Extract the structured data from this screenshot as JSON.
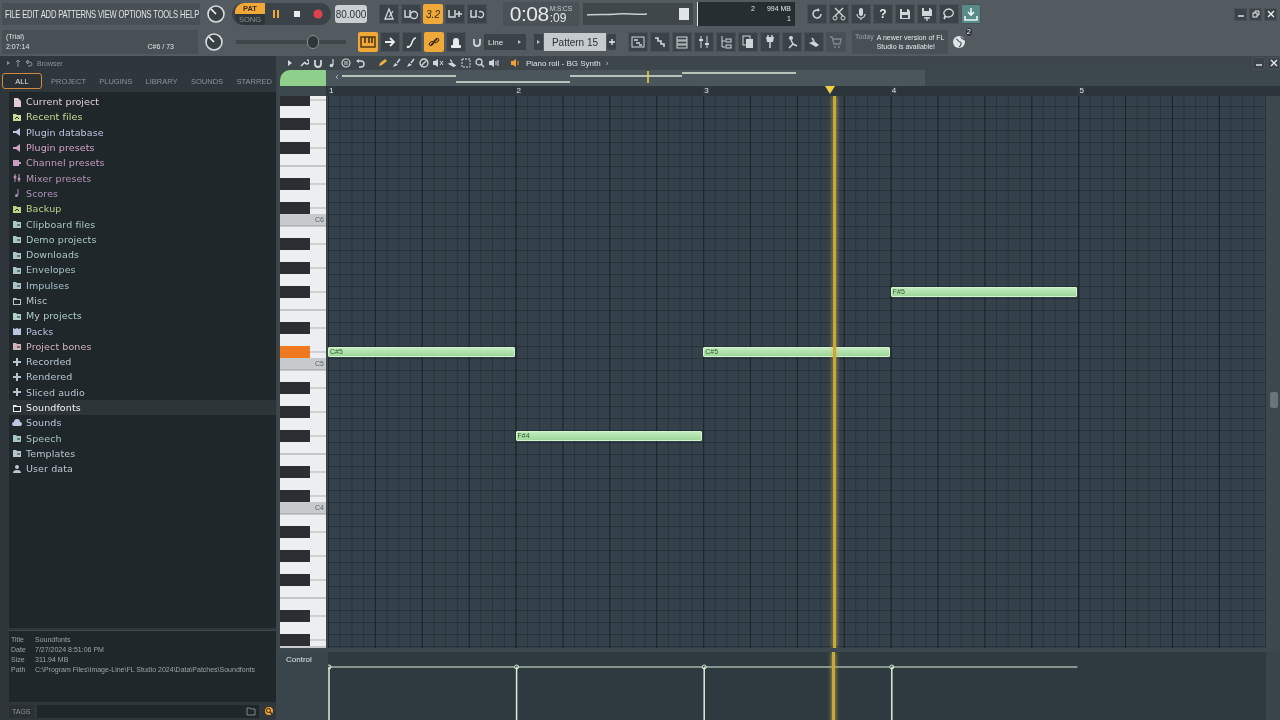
{
  "menu": [
    "FILE",
    "EDIT",
    "ADD",
    "PATTERNS",
    "VIEW",
    "OPTIONS",
    "TOOLS",
    "HELP"
  ],
  "hint_bar": {
    "status": "(Trial)",
    "time": "2:07:14",
    "note": "C#6 / 73"
  },
  "transport": {
    "pat_label": "PAT",
    "song_label": "SONG",
    "pat_selected": true,
    "tempo": "80.000"
  },
  "master_volume": {
    "level": 0.7
  },
  "toolbar_1": [
    {
      "on": false
    },
    {
      "on": false
    },
    {
      "label": "3.2",
      "on": true
    },
    {
      "on": false
    },
    {
      "on": false
    }
  ],
  "time_display": {
    "time": "0:08",
    "centiseconds": ":09",
    "unit": "M:S:CS"
  },
  "monitor": {
    "cpu": "2",
    "memory": "994 MB",
    "polyphony": "1"
  },
  "help_label": "?",
  "toolbar_2": [
    {
      "on": true
    },
    {
      "on": false
    },
    {
      "on": false
    },
    {
      "on": true
    },
    {
      "on": false
    }
  ],
  "snap": {
    "value": "Line"
  },
  "pattern": {
    "name": "Pattern 15"
  },
  "news": {
    "date": "Today",
    "message": "A newer version of FL Studio is available!",
    "count": "2"
  },
  "browser": {
    "title": "Browser",
    "tabs": [
      {
        "label": "ALL",
        "selected": true
      },
      {
        "label": "PROJECT",
        "selected": false
      },
      {
        "label": "PLUGINS",
        "selected": false
      },
      {
        "label": "LIBRARY",
        "selected": false
      },
      {
        "label": "SOUNDS",
        "selected": false
      },
      {
        "label": "STARRED",
        "selected": false
      }
    ],
    "items": [
      {
        "label": "Current project",
        "kind": "file",
        "color": "#e2ccd4",
        "selected": false
      },
      {
        "label": "Recent files",
        "kind": "recent",
        "color": "#cadc94",
        "selected": false
      },
      {
        "label": "Plugin database",
        "kind": "plugin",
        "color": "#bcc8e2",
        "selected": false
      },
      {
        "label": "Plugin presets",
        "kind": "plugin",
        "color": "#d8a2c8",
        "selected": false
      },
      {
        "label": "Channel presets",
        "kind": "channel",
        "color": "#c89cc0",
        "selected": false
      },
      {
        "label": "Mixer presets",
        "kind": "mixer",
        "color": "#b894b8",
        "selected": false
      },
      {
        "label": "Scores",
        "kind": "note",
        "color": "#aa94ba",
        "selected": false
      },
      {
        "label": "Backup",
        "kind": "recent",
        "color": "#bcd484",
        "selected": false
      },
      {
        "label": "Clipboard files",
        "kind": "folder",
        "color": "#aac8c2",
        "selected": false
      },
      {
        "label": "Demo projects",
        "kind": "folder",
        "color": "#aac8c8",
        "selected": false
      },
      {
        "label": "Downloads",
        "kind": "folder",
        "color": "#aac6ca",
        "selected": false
      },
      {
        "label": "Envelopes",
        "kind": "folder",
        "color": "#a8c4c8",
        "selected": false
      },
      {
        "label": "Impulses",
        "kind": "folder",
        "color": "#a8c2ca",
        "selected": false
      },
      {
        "label": "Misc",
        "kind": "plainfolder",
        "color": "#b8c4c8",
        "selected": false
      },
      {
        "label": "My projects",
        "kind": "folder",
        "color": "#b0d0c8",
        "selected": false
      },
      {
        "label": "Packs",
        "kind": "packs",
        "color": "#bac6e0",
        "selected": false
      },
      {
        "label": "Project bones",
        "kind": "folder",
        "color": "#d2b2b8",
        "selected": false
      },
      {
        "label": "Recorded",
        "kind": "audio",
        "color": "#b8c8d2",
        "selected": false
      },
      {
        "label": "Rendered",
        "kind": "audio",
        "color": "#b6c6d0",
        "selected": false
      },
      {
        "label": "Sliced audio",
        "kind": "audio",
        "color": "#b4c4ce",
        "selected": false
      },
      {
        "label": "Soundfonts",
        "kind": "plainfolder",
        "color": "#f2f4f4",
        "selected": true
      },
      {
        "label": "Sounds",
        "kind": "cloud",
        "color": "#bcc8e2",
        "selected": false
      },
      {
        "label": "Speech",
        "kind": "folder",
        "color": "#a8c6c8",
        "selected": false
      },
      {
        "label": "Templates",
        "kind": "folder",
        "color": "#b6c6ce",
        "selected": false
      },
      {
        "label": "User data",
        "kind": "user",
        "color": "#b8c8d0",
        "selected": false
      }
    ],
    "info": [
      {
        "label": "Title",
        "value": "Soundfonts"
      },
      {
        "label": "Date",
        "value": "7/27/2024 8:51:06 PM"
      },
      {
        "label": "Size",
        "value": "311.94 MB"
      },
      {
        "label": "Path",
        "value": "C:\\Program Files\\Image-Line\\FL Studio 2024\\Data\\Patches\\Soundfonts"
      }
    ],
    "tags_label": "TAGS"
  },
  "piano_roll": {
    "title": "Piano roll - BG Synth",
    "title_arrow": "›",
    "bars": [
      "1",
      "2",
      "3",
      "4",
      "5"
    ],
    "octaves": [
      "C6",
      "C5",
      "C4"
    ],
    "notes": [
      {
        "label": "C#5"
      },
      {
        "label": "F#4"
      },
      {
        "label": "C#5"
      },
      {
        "label": "F#5"
      }
    ],
    "control_label": "Control"
  }
}
